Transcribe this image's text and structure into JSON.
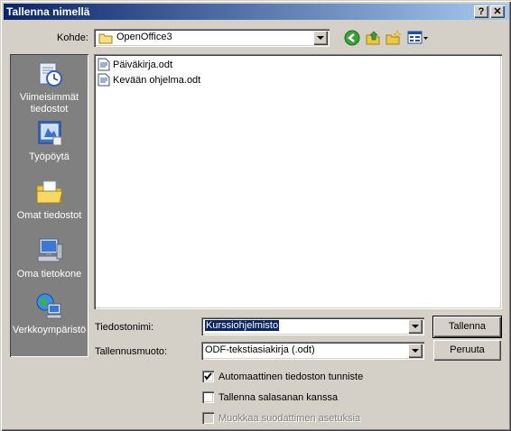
{
  "window": {
    "title": "Tallenna nimellä",
    "help_label": "?",
    "close_label": "✕"
  },
  "location": {
    "label": "Kohde:",
    "value": "OpenOffice3"
  },
  "toolbar": {
    "back_icon": "back-icon",
    "up_icon": "up-folder-icon",
    "new_folder_icon": "new-folder-icon",
    "view_icon": "view-menu-icon"
  },
  "places": [
    {
      "label": "Viimeisimmät tiedostot",
      "icon": "recent-documents-icon"
    },
    {
      "label": "Työpöytä",
      "icon": "desktop-icon"
    },
    {
      "label": "Omat tiedostot",
      "icon": "my-documents-icon"
    },
    {
      "label": "Oma tietokone",
      "icon": "my-computer-icon"
    },
    {
      "label": "Verkkoympäristö",
      "icon": "network-icon"
    }
  ],
  "files": [
    {
      "name": "Päiväkirja.odt"
    },
    {
      "name": "Kevään ohjelma.odt"
    }
  ],
  "filename": {
    "label": "Tiedostonimi:",
    "value": "Kurssiohjelmisto"
  },
  "filetype": {
    "label": "Tallennusmuoto:",
    "value": "ODF-tekstiasiakirja (.odt)"
  },
  "buttons": {
    "save": "Tallenna",
    "cancel": "Peruuta"
  },
  "options": [
    {
      "label": "Automaattinen tiedoston tunniste",
      "checked": true,
      "disabled": false
    },
    {
      "label": "Tallenna salasanan kanssa",
      "checked": false,
      "disabled": false
    },
    {
      "label": "Muokkaa suodattimen asetuksia",
      "checked": false,
      "disabled": true
    }
  ]
}
